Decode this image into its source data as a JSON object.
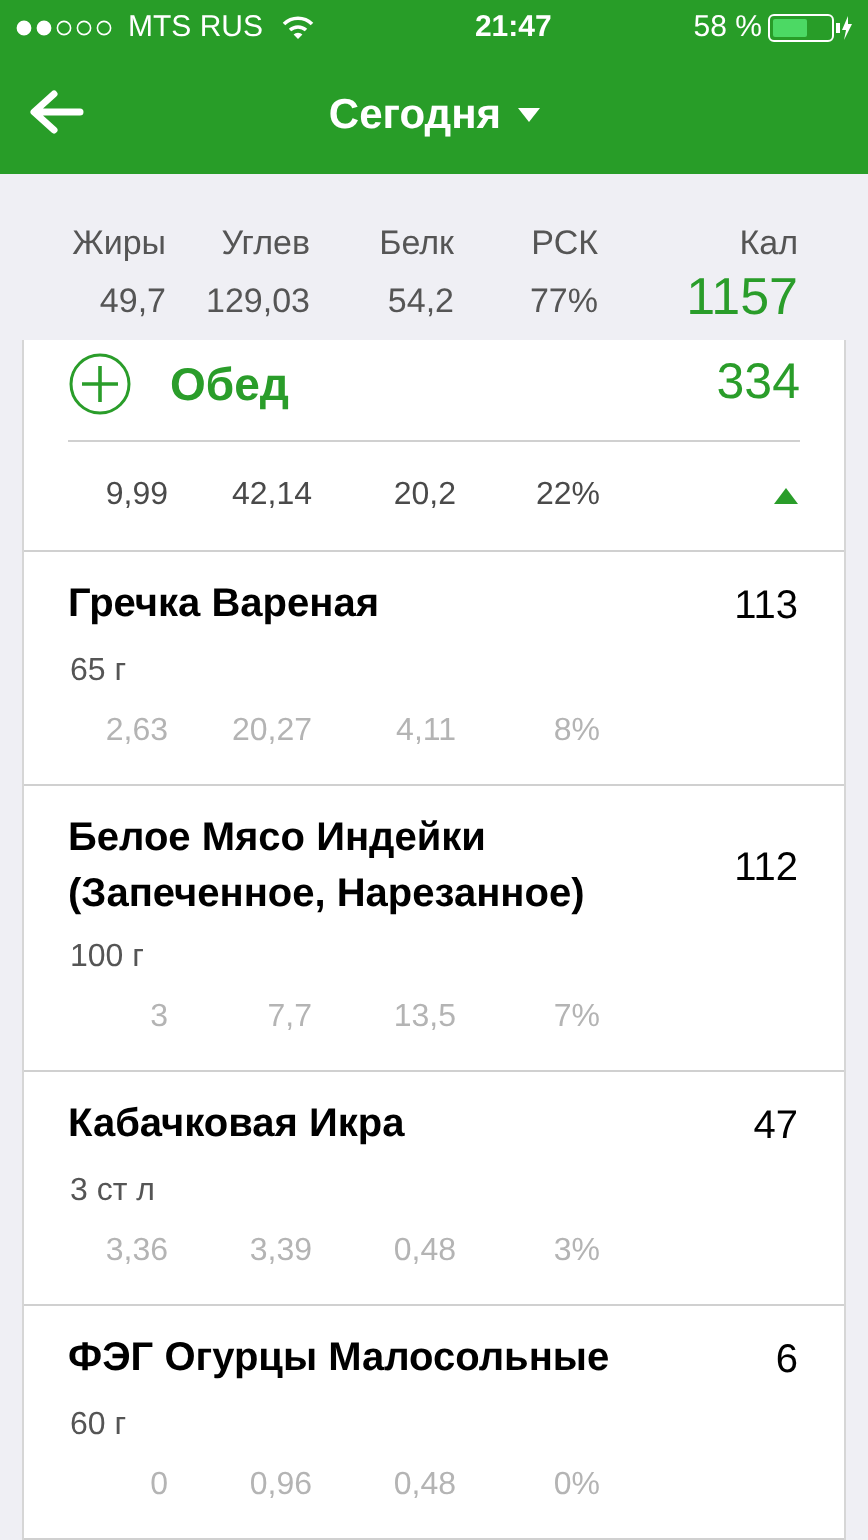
{
  "status_bar": {
    "carrier": "MTS RUS",
    "time": "21:47",
    "battery": "58 %"
  },
  "nav": {
    "title": "Сегодня"
  },
  "summary": {
    "columns": [
      {
        "label": "Жиры",
        "value": "49,7"
      },
      {
        "label": "Углев",
        "value": "129,03"
      },
      {
        "label": "Белк",
        "value": "54,2"
      },
      {
        "label": "РСК",
        "value": "77%"
      }
    ],
    "calories": {
      "label": "Кал",
      "value": "1157"
    }
  },
  "meal": {
    "name": "Обед",
    "calories": "334",
    "expanded": true,
    "macros": [
      "9,99",
      "42,14",
      "20,2",
      "22%"
    ]
  },
  "items": [
    {
      "name": "Гречка Вареная",
      "calories": "113",
      "portion": "65 г",
      "macros": [
        "2,63",
        "20,27",
        "4,11",
        "8%"
      ]
    },
    {
      "name": "Белое Мясо Индейки (Запеченное, Нарезанное)",
      "calories": "112",
      "portion": "100 г",
      "macros": [
        "3",
        "7,7",
        "13,5",
        "7%"
      ]
    },
    {
      "name": "Кабачковая Икра",
      "calories": "47",
      "portion": "3 ст л",
      "macros": [
        "3,36",
        "3,39",
        "0,48",
        "3%"
      ]
    },
    {
      "name": "ФЭГ Огурцы Малосольные",
      "calories": "6",
      "portion": "60 г",
      "macros": [
        "0",
        "0,96",
        "0,48",
        "0%"
      ]
    }
  ]
}
